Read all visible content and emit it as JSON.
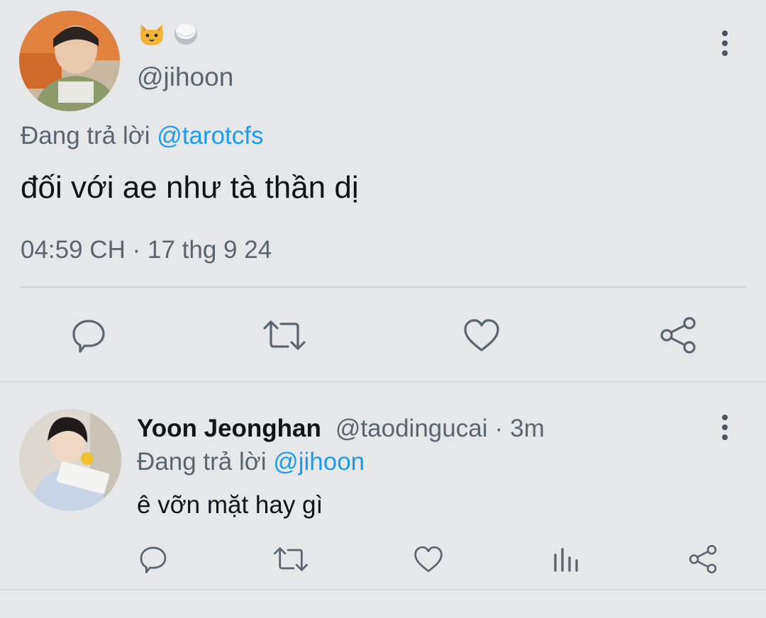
{
  "main_tweet": {
    "display_name_emojis": [
      "cat-face",
      "rice-ball"
    ],
    "handle": "@jihoon",
    "replying_prefix": "Đang trả lời",
    "replying_to": "@tarotcfs",
    "text": "đối với ae như tà thần dị",
    "time": "04:59 CH",
    "separator": "·",
    "date": "17 thg 9 24",
    "actions": [
      "reply-icon",
      "retweet-icon",
      "like-icon",
      "share-icon"
    ]
  },
  "reply_tweet": {
    "name": "Yoon Jeonghan",
    "handle": "@taodingucai",
    "separator": "·",
    "age": "3m",
    "replying_prefix": "Đang trả lời",
    "replying_to": "@jihoon",
    "text": "ê vỡn mặt hay gì",
    "actions": [
      "reply-icon",
      "retweet-icon",
      "like-icon",
      "analytics-icon",
      "share-icon"
    ]
  },
  "colors": {
    "background": "#e6e7e9",
    "text": "#0f1419",
    "secondary": "#5b6570",
    "link": "#1d9bf0",
    "icon": "#5b6570"
  }
}
